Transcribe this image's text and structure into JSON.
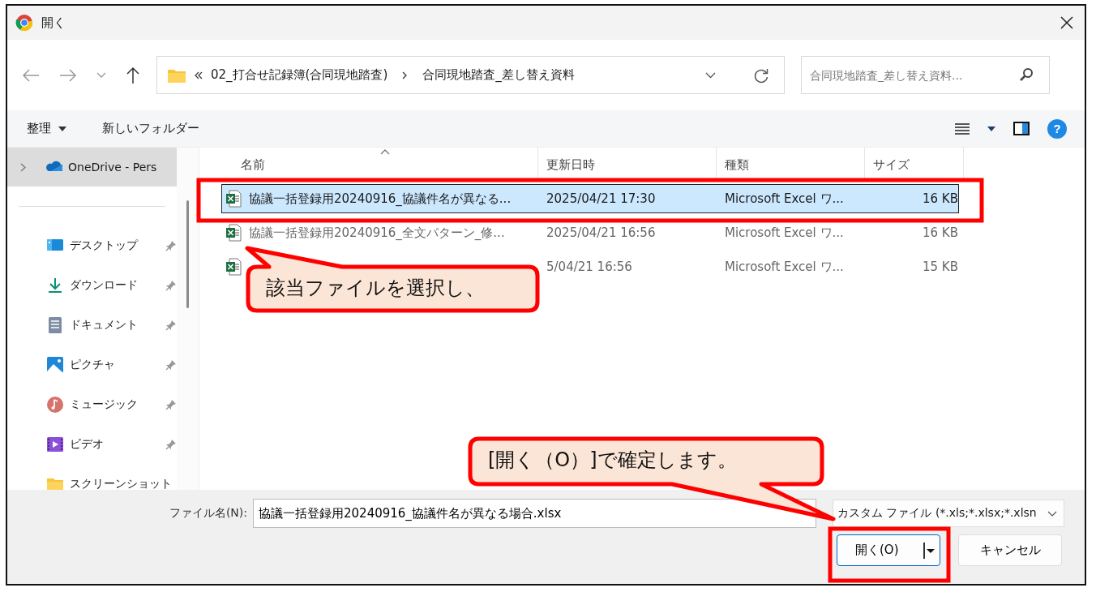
{
  "window": {
    "title": "開く"
  },
  "address": {
    "segments": [
      "02_打合せ記録簿(合同現地踏査)",
      "合同現地踏査_差し替え資料"
    ]
  },
  "search": {
    "placeholder": "合同現地踏査_差し替え資料..."
  },
  "toolbar": {
    "organize": "整理",
    "new_folder": "新しいフォルダー",
    "help": "?"
  },
  "sidebar": {
    "items": [
      {
        "kind": "cloud",
        "label": "OneDrive - Pers",
        "selected": true
      },
      {
        "kind": "desktop",
        "label": "デスクトップ",
        "selected": false,
        "pinned": true
      },
      {
        "kind": "download",
        "label": "ダウンロード",
        "selected": false,
        "pinned": true
      },
      {
        "kind": "document",
        "label": "ドキュメント",
        "selected": false,
        "pinned": true
      },
      {
        "kind": "picture",
        "label": "ピクチャ",
        "selected": false,
        "pinned": true
      },
      {
        "kind": "music",
        "label": "ミュージック",
        "selected": false,
        "pinned": true
      },
      {
        "kind": "video",
        "label": "ビデオ",
        "selected": false,
        "pinned": true
      },
      {
        "kind": "folder",
        "label": "スクリーンショット",
        "selected": false
      }
    ]
  },
  "table": {
    "columns": [
      {
        "label": "名前",
        "sorted": true
      },
      {
        "label": "更新日時"
      },
      {
        "label": "種類"
      },
      {
        "label": "サイズ"
      }
    ],
    "rows": [
      {
        "name": "協議一括登録用20240916_協議件名が異なる...",
        "modified": "2025/04/21 17:30",
        "type": "Microsoft Excel ワ...",
        "size": "16 KB",
        "selected": true
      },
      {
        "name": "協議一括登録用20240916_全文パターン_修...",
        "modified": "2025/04/21 16:56",
        "type": "Microsoft Excel ワ...",
        "size": "16 KB",
        "selected": false
      },
      {
        "modified": "5/04/21 16:56",
        "type": "Microsoft Excel ワ...",
        "size": "15 KB",
        "selected": false
      }
    ]
  },
  "footer": {
    "filename_label": "ファイル名(N):",
    "filename": "協議一括登録用20240916_協議件名が異なる場合.xlsx",
    "filter": "カスタム ファイル (*.xls;*.xlsx;*.xlsn",
    "open_button": "開く(O)",
    "cancel_button": "キャンセル"
  },
  "annotations": {
    "callouts": [
      "該当ファイルを選択し、",
      "[開く（O）]で確定します。"
    ]
  }
}
